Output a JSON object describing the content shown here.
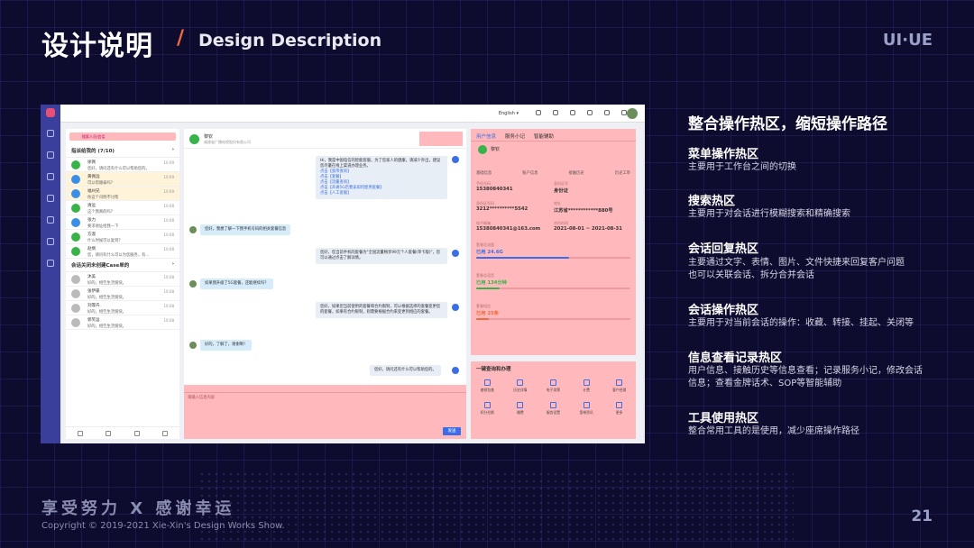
{
  "header": {
    "title": "设计说明",
    "slash": "/",
    "subtitle": "Design Description",
    "brand": "UI·UE"
  },
  "footer": {
    "slogan": "享受努力 X 感谢幸运",
    "copyright": "Copyright © 2019-2021 Xie-Xin's Design Works Show.",
    "page": "21"
  },
  "app": {
    "language": "English ▾",
    "list": {
      "search_placeholder": "搜索人员/会话",
      "section1": "指派给我的 (7/10)",
      "section2": "会话关闭未创建Case单的",
      "rows": [
        {
          "name": "徐佩",
          "msg": "您好，请问还有什么可以帮助您的。",
          "time": "10:09"
        },
        {
          "name": "黄佩远",
          "msg": "可以帮顺泰吗？",
          "time": "10:09"
        },
        {
          "name": "福州兄",
          "msg": "你这个司明不讨帮",
          "time": "10:09"
        },
        {
          "name": "清远",
          "msg": "这个我真的吗？",
          "time": "10:08"
        },
        {
          "name": "张力",
          "msg": "要求地址给我一下",
          "time": "10:08"
        },
        {
          "name": "方淑",
          "msg": "什么时候可以复到？",
          "time": "10:08"
        },
        {
          "name": "赵纲",
          "msg": "您，请问有什么可以为您服务，有...",
          "time": "10:08"
        },
        {
          "name": "沐美",
          "msg": "好的，相告生活愉快。",
          "time": "10:08"
        },
        {
          "name": "张伊豪",
          "msg": "好的，相告生活愉快。",
          "time": "10:08"
        },
        {
          "name": "刘霏卉",
          "msg": "好的，相告生活愉快。",
          "time": "10:08"
        },
        {
          "name": "郭笑运",
          "msg": "好的，相告生活愉快。",
          "time": "10:08"
        },
        {
          "name": "赵贝庆",
          "msg": "好的，相告生活愉快。",
          "time": "10:08"
        },
        {
          "name": "王特",
          "msg": "好的，相告生活愉快。",
          "time": "10:08"
        }
      ]
    },
    "chat": {
      "contact": "黎钦",
      "org": "福建省广播电视股份有限公司",
      "welcome": "Hi，我是中国电信的智能客服，为了您家人的健康，请减少外出，建议您尽量在线上渠道办理业务。",
      "links": [
        "点击【宽带查询】",
        "点击【套餐】",
        "点击【流量查询】",
        "点击【开通5G后我该如何使用套餐】",
        "点击【人工客服】"
      ],
      "msgs": [
        "您好，我想了解一下我手机号码的相关套餐信息",
        "您好，您当前手机的套餐为\"全国流量畅享99元个人套餐(单卡版)\"，您可以通过点击了解详情。",
        "如果我升级了5G套餐，还能继续吗？",
        "您好，如果您当前使用的套餐和合约限制，可以根据选择的套餐变更您的套餐，如果有合约限制，则需要根据合约来变更到相应的套餐。",
        "好的，了解了，谢谢啊！",
        "您好，请问还有什么可以帮助您的。"
      ],
      "reply_placeholder": "请输入信息内容",
      "send": "发送"
    },
    "info": {
      "tabs": [
        "用户信息",
        "服务小记",
        "智能辅助"
      ],
      "name": "黎钦",
      "sub_tabs": [
        "基础信息",
        "账户信息",
        "接触历史",
        "历史工单"
      ],
      "fields": [
        {
          "label": "手机号码",
          "value": "15380840341"
        },
        {
          "label": "身份证号",
          "value": "身份证"
        },
        {
          "label": "身份证号码",
          "value": "3212**********5542"
        },
        {
          "label": "地址",
          "value": "江苏省************880号"
        },
        {
          "label": "电子邮箱",
          "value": "15380840341@163.com"
        },
        {
          "label": "合约时间",
          "value": "2021-08-01 ~ 2021-08-31"
        }
      ],
      "usage": [
        {
          "label": "套餐总流量",
          "value": "已用 24.6G",
          "pct": 0.6,
          "color": "#3a6ee6"
        },
        {
          "label": "套餐总语音",
          "value": "已用 134分钟",
          "pct": 0.15,
          "color": "#38b34a"
        },
        {
          "label": "套餐短信",
          "value": "已用 25条",
          "pct": 0.08,
          "color": "#f06a3b"
        }
      ],
      "tools_title": "一键查询和办理",
      "tools": [
        "套餐包查",
        "历史详情",
        "电子发票",
        "计费",
        "客户经理",
        "积分兑换",
        "缴费",
        "服务设置",
        "宽带资讯",
        "更多"
      ]
    }
  },
  "right": {
    "title": "整合操作热区，缩短操作路径",
    "items": [
      {
        "h": "菜单操作热区",
        "d": "主要用于工作台之间的切换"
      },
      {
        "h": "搜索热区",
        "d": "主要用于对会话进行模糊搜索和精确搜索"
      },
      {
        "h": "会话回复热区",
        "d": "主要通过文字、表情、图片、文件快捷来回复客户问题",
        "d2": "也可以关联会话、拆分合并会话"
      },
      {
        "h": "会话操作热区",
        "d": "主要用于对当前会话的操作：收藏、转接、挂起、关闭等"
      },
      {
        "h": "信息查看记录热区",
        "d": "用户信息、接触历史等信息查看；记录服务小记，修改会话",
        "d2": "信息；查看金牌话术、SOP等智能辅助"
      },
      {
        "h": "工具使用热区",
        "d": "整合常用工具的是使用，减少座席操作路径"
      }
    ]
  }
}
